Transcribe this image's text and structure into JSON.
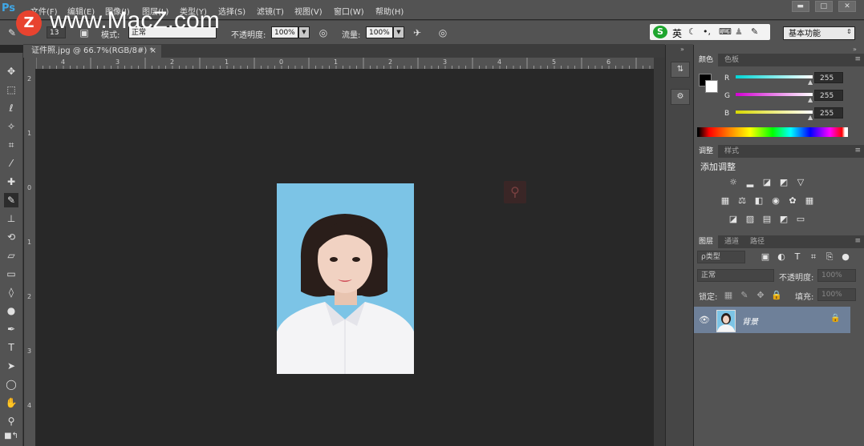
{
  "app": {
    "logo": "Ps"
  },
  "menu": [
    "文件(F)",
    "编辑(E)",
    "图像(I)",
    "图层(L)",
    "类型(Y)",
    "选择(S)",
    "滤镜(T)",
    "视图(V)",
    "窗口(W)",
    "帮助(H)"
  ],
  "window_controls": {
    "minimize": "▬",
    "maximize": "□",
    "close": "✕"
  },
  "options": {
    "brush_size": "13",
    "mode_label": "模式:",
    "mode_value": "正常",
    "opacity_label": "不透明度:",
    "opacity_value": "100%",
    "flow_label": "流量:",
    "flow_value": "100%"
  },
  "ime": {
    "logo": "S",
    "lang": "英"
  },
  "workspace": "基本功能",
  "watermark": {
    "badge": "Z",
    "text": "www.MacZ.com"
  },
  "document": {
    "tab": "证件照.jpg @ 66.7%(RGB/8#) *",
    "close": "×"
  },
  "rulers": {
    "horizontal": [
      "4",
      "3",
      "2",
      "1",
      "0",
      "1",
      "2",
      "3",
      "4",
      "5",
      "6"
    ],
    "vertical": [
      "2",
      "1",
      "0",
      "1",
      "2",
      "3",
      "4"
    ]
  },
  "color_panel": {
    "tabs": [
      "颜色",
      "色板"
    ],
    "channels": [
      {
        "label": "R",
        "value": "255",
        "color": "#00d6d6"
      },
      {
        "label": "G",
        "value": "255",
        "color": "#d200d2"
      },
      {
        "label": "B",
        "value": "255",
        "color": "#d8d800"
      }
    ],
    "foreground": "#000000",
    "background": "#ffffff"
  },
  "adjust_panel": {
    "tabs": [
      "调整",
      "样式"
    ],
    "title": "添加调整"
  },
  "layers_panel": {
    "tabs": [
      "图层",
      "通道",
      "路径"
    ],
    "filter_label": "ρ类型",
    "blend_mode": "正常",
    "opacity_label": "不透明度:",
    "opacity_value": "100%",
    "lock_label": "锁定:",
    "fill_label": "填充:",
    "fill_value": "100%",
    "layers": [
      {
        "name": "背景",
        "visible": true,
        "locked": true
      }
    ]
  },
  "colors": {
    "accent": "#3fa7e6",
    "photo_bg": "#7cc4e6",
    "layer_selected": "#6e8099"
  }
}
